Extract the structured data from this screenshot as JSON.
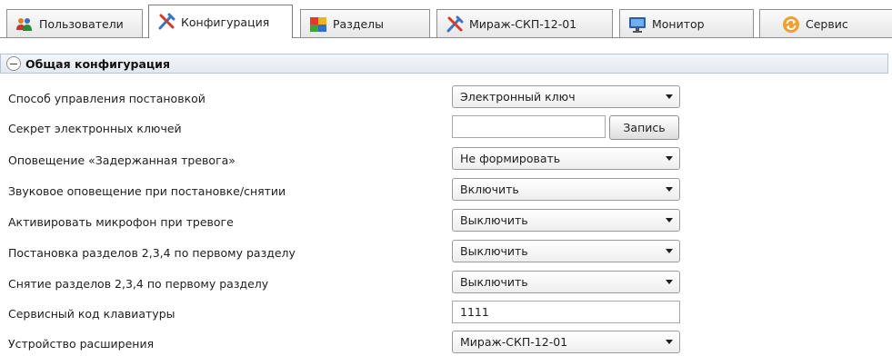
{
  "tabs": [
    {
      "label": "Пользователи",
      "icon": "users-icon"
    },
    {
      "label": "Конфигурация",
      "icon": "tools-icon",
      "active": true
    },
    {
      "label": "Разделы",
      "icon": "partitions-icon"
    },
    {
      "label": "Мираж-СКП-12-01",
      "icon": "device-tools-icon"
    },
    {
      "label": "Монитор",
      "icon": "monitor-icon"
    },
    {
      "label": "Сервис",
      "icon": "service-icon"
    }
  ],
  "section": {
    "title": "Общая конфигурация"
  },
  "settings": [
    {
      "label": "Способ управления постановкой",
      "value": "Электронный ключ"
    },
    {
      "label": "Секрет электронных ключей",
      "value": "",
      "button": "Запись"
    },
    {
      "label": "Оповещение «Задержанная тревога»",
      "value": "Не формировать"
    },
    {
      "label": "Звуковое оповещение при постановке/снятии",
      "value": "Включить"
    },
    {
      "label": "Активировать микрофон при тревоге",
      "value": "Выключить"
    },
    {
      "label": "Постановка разделов 2,3,4 по первому разделу",
      "value": "Выключить"
    },
    {
      "label": "Снятие разделов 2,3,4 по первому разделу",
      "value": "Выключить"
    },
    {
      "label": "Сервисный код клавиатуры",
      "value": "1111"
    },
    {
      "label": "Устройство расширения",
      "value": "Мираж-СКП-12-01"
    }
  ],
  "colors": {
    "header_bg": "#e3e9f1",
    "header_border": "#b5c3d6",
    "accent": "#f0a030"
  }
}
